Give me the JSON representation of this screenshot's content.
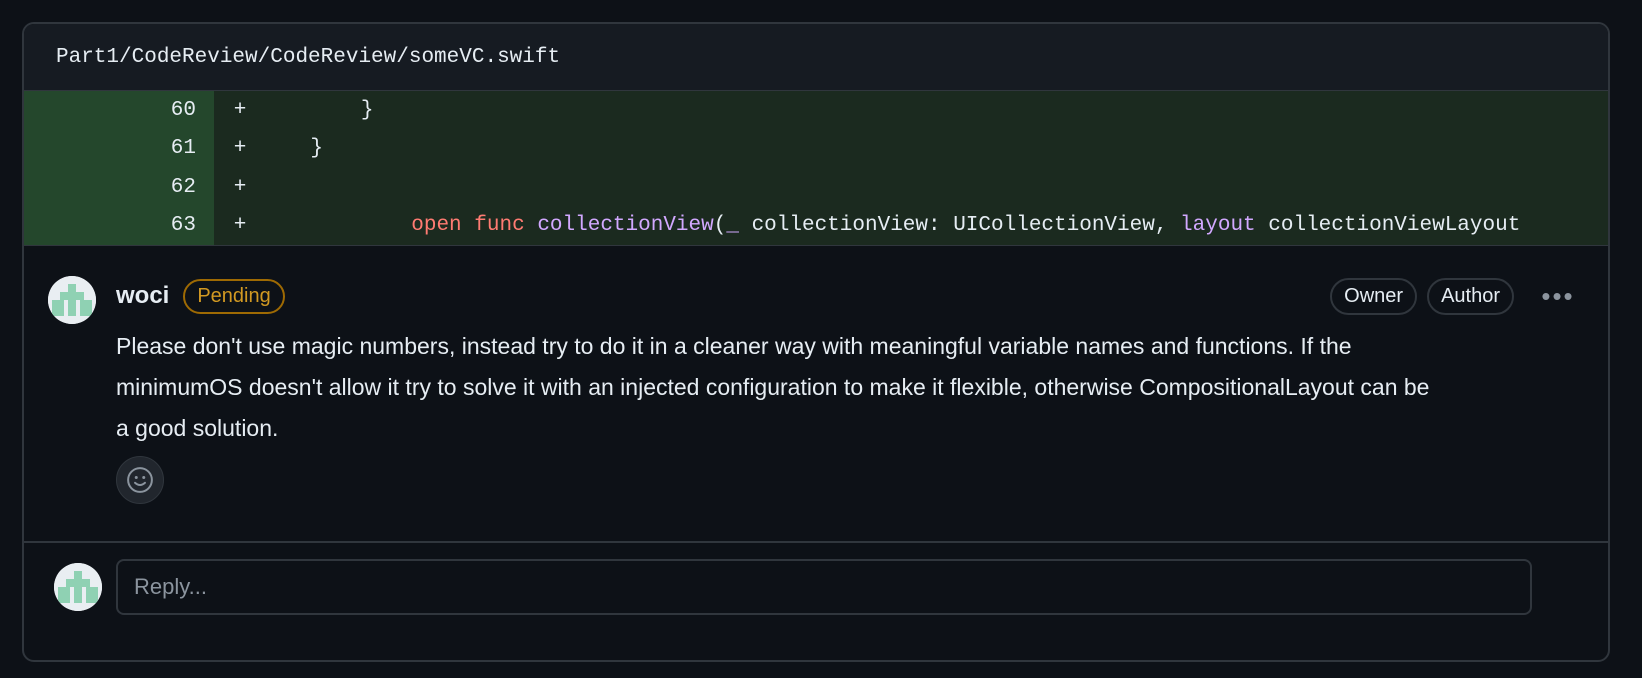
{
  "file": {
    "path": "Part1/CodeReview/CodeReview/someVC.swift"
  },
  "diff": {
    "lines": [
      {
        "num": "60",
        "sign": "+",
        "code": "        }"
      },
      {
        "num": "61",
        "sign": "+",
        "code": "    }"
      },
      {
        "num": "62",
        "sign": "+",
        "code": ""
      },
      {
        "num": "63",
        "sign": "+",
        "code_parts": [
          {
            "t": "    ",
            "c": "plain"
          },
          {
            "t": "open",
            "c": "kw"
          },
          {
            "t": " ",
            "c": "plain"
          },
          {
            "t": "func",
            "c": "kw"
          },
          {
            "t": " ",
            "c": "plain"
          },
          {
            "t": "collectionView",
            "c": "fn"
          },
          {
            "t": "(",
            "c": "plain"
          },
          {
            "t": "_",
            "c": "fn"
          },
          {
            "t": " collectionView: UICollectionView, ",
            "c": "plain"
          },
          {
            "t": "layout",
            "c": "fn"
          },
          {
            "t": " collectionViewLayout",
            "c": "plain"
          }
        ]
      }
    ]
  },
  "comment": {
    "author": "woci",
    "status_badge": "Pending",
    "role_badges": [
      "Owner",
      "Author"
    ],
    "more_label": "•••",
    "body": "Please don't use magic numbers, instead try to do it in a cleaner way with meaningful variable names and functions. If the minimumOS doesn't allow it try to solve it with an injected configuration to make it flexible, otherwise CompositionalLayout can be a good solution."
  },
  "reply": {
    "placeholder": "Reply..."
  },
  "icons": {
    "avatar": "identicon-avatar",
    "reaction": "smiley-icon",
    "more": "kebab-icon"
  },
  "colors": {
    "added_line_bg": "#1b2a1f",
    "added_gutter_bg": "#24472c",
    "pending": "#d29922",
    "keyword": "#ff7b72",
    "function": "#d2a8ff"
  }
}
